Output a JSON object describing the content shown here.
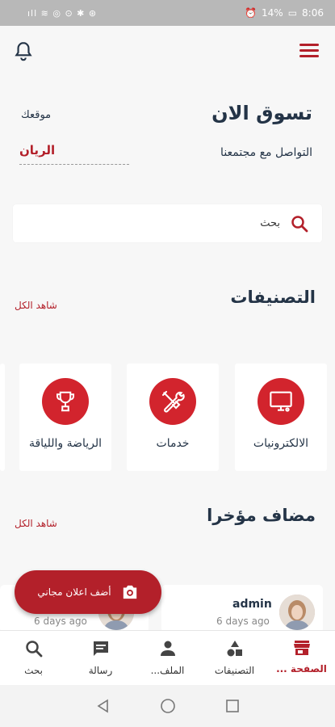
{
  "status": {
    "left": "ıll ≋ ◎ ⊙ ✱ ⊛",
    "battery": "14%",
    "time": "8:06"
  },
  "header": {
    "title": "تسوق الان",
    "subtitle": "التواصل مع مجتمعنا",
    "location_label": "موقعك",
    "location_value": "الريان"
  },
  "search": {
    "placeholder": "بحث"
  },
  "categories": {
    "title": "التصنيفات",
    "see_all": "شاهد الكل",
    "items": [
      {
        "label": "الالكترونيات",
        "icon": "monitor-icon"
      },
      {
        "label": "خدمات",
        "icon": "tools-icon"
      },
      {
        "label": "الرياضة واللياقة",
        "icon": "trophy-icon"
      }
    ]
  },
  "recent": {
    "title": "مضاف مؤخرا",
    "see_all": "شاهد الكل",
    "posts": [
      {
        "author": "admin",
        "ago": "6 days ago"
      },
      {
        "author": "",
        "ago": "6 days ago"
      }
    ]
  },
  "fab": {
    "label": "أضف اعلان مجاني"
  },
  "bottom_nav": [
    {
      "label": "الصفحة ...",
      "icon": "store-icon",
      "active": true
    },
    {
      "label": "التصنيفات",
      "icon": "shapes-icon"
    },
    {
      "label": "الملف...",
      "icon": "person-icon"
    },
    {
      "label": "رسالة",
      "icon": "chat-icon"
    },
    {
      "label": "بحث",
      "icon": "search-icon"
    }
  ],
  "colors": {
    "accent": "#b3202a",
    "category_circle": "#d2242d",
    "heading": "#243447"
  }
}
